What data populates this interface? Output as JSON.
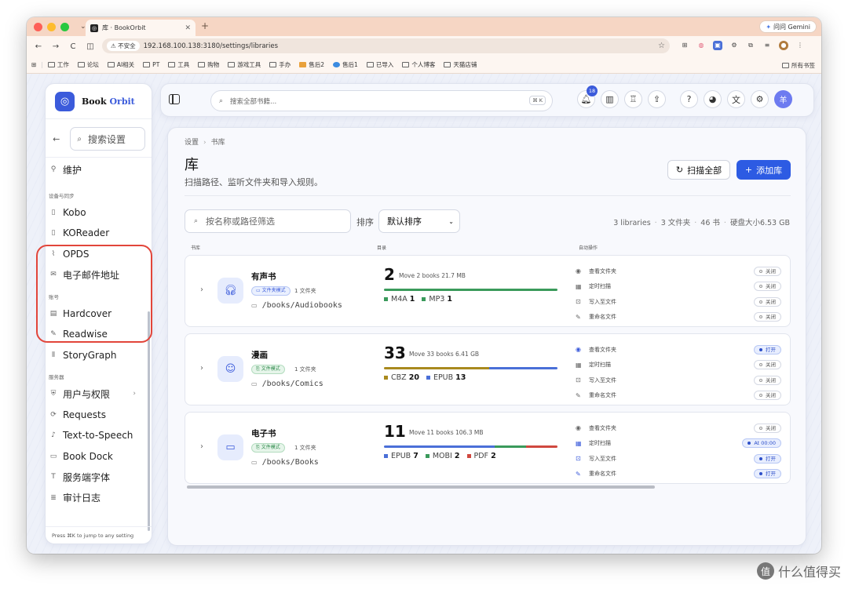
{
  "browser": {
    "tab_title": "库 · BookOrbit",
    "gemini_label": "问问 Gemini",
    "insecure_label": "不安全",
    "url": "192.168.100.138:3180/settings/libraries",
    "bookmarks": [
      "工作",
      "论坛",
      "AI相关",
      "PT",
      "工具",
      "购物",
      "游戏工具",
      "手办",
      "售后2",
      "售后1",
      "已导入",
      "个人博客",
      "天猫店铺"
    ],
    "bookmarks_all": "所有书签"
  },
  "sidebar": {
    "brand_a": "Book",
    "brand_b": "Orbit",
    "search_placeholder": "搜索设置",
    "top_item": "维护",
    "groups": [
      {
        "title": "设备与同步",
        "items": [
          {
            "label": "Kobo",
            "icon": "tablet-icon"
          },
          {
            "label": "KOReader",
            "icon": "tablet-icon"
          },
          {
            "label": "OPDS",
            "icon": "rss-icon"
          },
          {
            "label": "电子邮件地址",
            "icon": "mail-icon"
          }
        ]
      },
      {
        "title": "账号",
        "items": [
          {
            "label": "Hardcover",
            "icon": "book-icon"
          },
          {
            "label": "Readwise",
            "icon": "highlighter-icon"
          },
          {
            "label": "StoryGraph",
            "icon": "library-icon"
          }
        ]
      },
      {
        "title": "服务器",
        "items": [
          {
            "label": "用户与权限",
            "icon": "shield-icon",
            "chevron": true
          },
          {
            "label": "Requests",
            "icon": "request-icon"
          },
          {
            "label": "Text-to-Speech",
            "icon": "speech-icon"
          },
          {
            "label": "Book Dock",
            "icon": "dock-icon"
          },
          {
            "label": "服务端字体",
            "icon": "type-icon"
          },
          {
            "label": "审计日志",
            "icon": "log-icon"
          }
        ]
      }
    ],
    "footer": "Press ⌘K to jump to any setting"
  },
  "topbar": {
    "search_placeholder": "搜索全部书籍...",
    "shortcut": "⌘ K",
    "notification_count": "18",
    "avatar": "羊"
  },
  "page": {
    "breadcrumb": [
      "设置",
      "书库"
    ],
    "title": "库",
    "subtitle": "扫描路径、监听文件夹和导入规则。",
    "scan_all": "扫描全部",
    "add_library": "添加库",
    "filter_placeholder": "按名称或路径筛选",
    "sort_label": "排序",
    "sort_value": "默认排序",
    "stats": [
      "3 libraries",
      "3 文件夹",
      "46 书",
      "硬盘大小6.53 GB"
    ],
    "col_headers": [
      "书库",
      "目录",
      "自动操作"
    ]
  },
  "libraries": [
    {
      "name": "有声书",
      "mode": "文件夹模式",
      "mode_color": "blue",
      "folders": "1 文件夹",
      "path": "/books/Audiobooks",
      "count": "2",
      "move": "Move 2 books",
      "size": "21.7 MB",
      "formats": [
        {
          "label": "M4A",
          "count": "1",
          "color": "#3a9a5b"
        },
        {
          "label": "MP3",
          "count": "1",
          "color": "#3a9a5b"
        }
      ],
      "bar": [
        {
          "frac": 0.5,
          "color": "#3a9a5b"
        },
        {
          "frac": 0.5,
          "color": "#3a9a5b"
        }
      ],
      "actions": [
        {
          "label": "查看文件夹",
          "state": "关闭",
          "on": false,
          "icon": "eye-icon"
        },
        {
          "label": "定时扫描",
          "state": "关闭",
          "on": false,
          "icon": "calendar-icon"
        },
        {
          "label": "写入至文件",
          "state": "关闭",
          "on": false,
          "icon": "file-write-icon"
        },
        {
          "label": "重命名文件",
          "state": "关闭",
          "on": false,
          "icon": "pencil-icon"
        }
      ]
    },
    {
      "name": "漫画",
      "mode": "文件模式",
      "mode_color": "green",
      "folders": "1 文件夹",
      "path": "/books/Comics",
      "count": "33",
      "move": "Move 33 books",
      "size": "6.41 GB",
      "formats": [
        {
          "label": "CBZ",
          "count": "20",
          "color": "#a98a1e"
        },
        {
          "label": "EPUB",
          "count": "13",
          "color": "#4a6fd8"
        }
      ],
      "bar": [
        {
          "frac": 0.606,
          "color": "#a98a1e"
        },
        {
          "frac": 0.394,
          "color": "#4a6fd8"
        }
      ],
      "actions": [
        {
          "label": "查看文件夹",
          "state": "打开",
          "on": true,
          "icon": "eye-icon"
        },
        {
          "label": "定时扫描",
          "state": "关闭",
          "on": false,
          "icon": "calendar-icon"
        },
        {
          "label": "写入至文件",
          "state": "关闭",
          "on": false,
          "icon": "file-write-icon"
        },
        {
          "label": "重命名文件",
          "state": "关闭",
          "on": false,
          "icon": "pencil-icon"
        }
      ]
    },
    {
      "name": "电子书",
      "mode": "文件模式",
      "mode_color": "green",
      "folders": "1 文件夹",
      "path": "/books/Books",
      "count": "11",
      "move": "Move 11 books",
      "size": "106.3 MB",
      "formats": [
        {
          "label": "EPUB",
          "count": "7",
          "color": "#4a6fd8"
        },
        {
          "label": "MOBI",
          "count": "2",
          "color": "#3a9a5b"
        },
        {
          "label": "PDF",
          "count": "2",
          "color": "#d0483f"
        }
      ],
      "bar": [
        {
          "frac": 0.636,
          "color": "#4a6fd8"
        },
        {
          "frac": 0.182,
          "color": "#3a9a5b"
        },
        {
          "frac": 0.182,
          "color": "#d0483f"
        }
      ],
      "actions": [
        {
          "label": "查看文件夹",
          "state": "关闭",
          "on": false,
          "icon": "eye-icon"
        },
        {
          "label": "定时扫描",
          "state": "At 00:00",
          "on": true,
          "icon": "calendar-icon"
        },
        {
          "label": "写入至文件",
          "state": "打开",
          "on": true,
          "icon": "file-write-icon"
        },
        {
          "label": "重命名文件",
          "state": "打开",
          "on": true,
          "icon": "pencil-icon"
        }
      ]
    }
  ],
  "watermark": "什么值得买"
}
